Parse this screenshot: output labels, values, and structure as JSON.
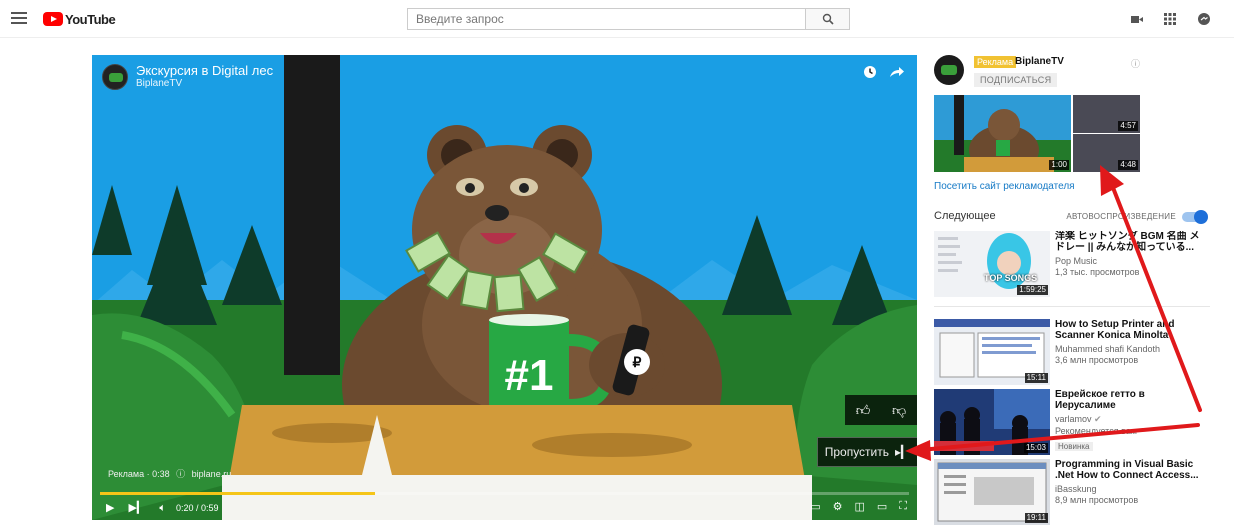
{
  "header": {
    "logo_text": "YouTube",
    "search_placeholder": "Введите запрос"
  },
  "player": {
    "title": "Экскурсия в Digital лес",
    "channel": "BiplaneTV",
    "ad_label": "Реклама · 0:38",
    "ad_site": "biplane.ru",
    "skip_label": "Пропустить",
    "time": "0:20 / 0:59",
    "progress": 0.34,
    "mug_text": "#1"
  },
  "ad_card": {
    "badge": "Реклама",
    "channel": "BiplaneTV",
    "subscribe": "ПОДПИСАТЬСЯ",
    "durations": [
      "1:00",
      "4:57",
      "4:48"
    ],
    "visit_link": "Посетить сайт рекламодателя"
  },
  "sidebar": {
    "next_label": "Следующее",
    "autoplay_label": "АВТОВОСПРОИЗВЕДЕНИЕ",
    "videos": [
      {
        "title": "洋楽 ヒットソング BGM 名曲 メドレー || みんなが知っている...",
        "channel": "Pop Music",
        "meta": "1,3 тыс. просмотров",
        "duration": "1:59:25",
        "thumb_text": "TOP SONGS"
      },
      {
        "title": "How to Setup Printer and Scanner Konica Minolta Bizhub...",
        "channel": "Muhammed shafi Kandoth",
        "meta": "3,6 млн просмотров",
        "duration": "15:11"
      },
      {
        "title": "Еврейское гетто в Иерусалиме",
        "channel": "varlamov",
        "meta": "Рекомендуется вам",
        "badge": "Новинка",
        "duration": "15:03"
      },
      {
        "title": "Programming in Visual Basic .Net How to Connect Access...",
        "channel": "iBasskung",
        "meta": "8,9 млн просмотров",
        "duration": "19:11"
      }
    ]
  },
  "colors": {
    "brand": "#ff0000",
    "progress": "#f5c518",
    "ad_badge": "#f1c232",
    "link": "#167ac6",
    "arrow": "#e0191b"
  }
}
